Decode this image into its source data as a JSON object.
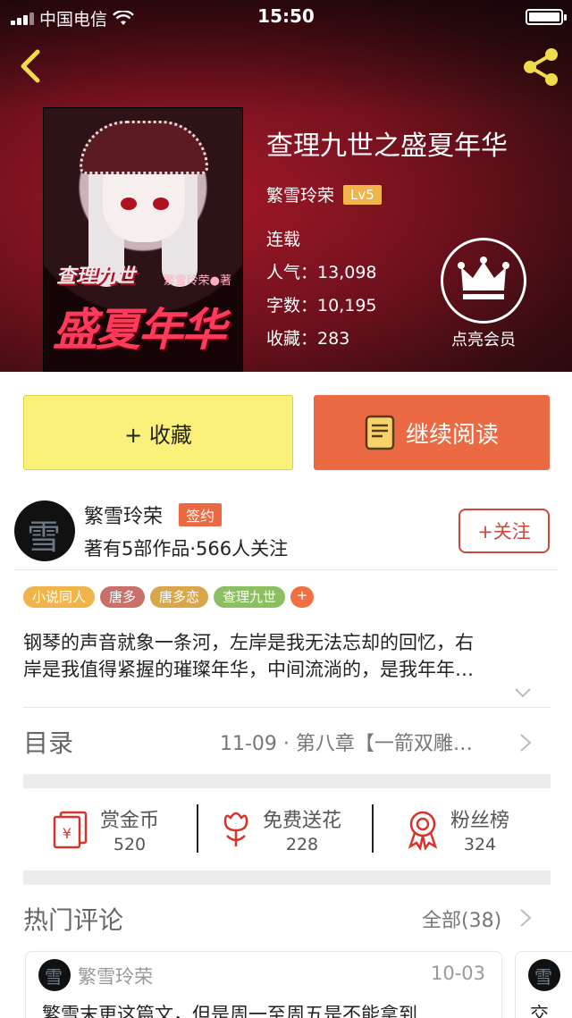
{
  "status_bar": {
    "carrier": "中国电信",
    "time": "15:50"
  },
  "book": {
    "title": "查理九世之盛夏年华",
    "author": "繁雪玲荣",
    "level": "Lv5",
    "status": "连载",
    "popularity_label": "人气：",
    "popularity": "13,098",
    "words_label": "字数：",
    "words": "10,195",
    "favorites_label": "收藏：",
    "favorites": "283",
    "cover_text_1": "查理九世",
    "cover_text_2": "盛夏年华",
    "cover_author_mark": "繁雪玲荣●著"
  },
  "member": {
    "label": "点亮会员"
  },
  "actions": {
    "favorite": "+ 收藏",
    "read": "继续阅读"
  },
  "author_card": {
    "name": "繁雪玲荣",
    "badge": "签约",
    "subtitle": "著有5部作品·566人关注",
    "follow": "+关注"
  },
  "tags": [
    {
      "label": "小说同人",
      "color": "#f0b44a"
    },
    {
      "label": "唐多",
      "color": "#c8716a"
    },
    {
      "label": "唐多恋",
      "color": "#d9a64a"
    },
    {
      "label": "查理九世",
      "color": "#8bbf62"
    },
    {
      "label": "+",
      "color": "#f0703f"
    }
  ],
  "description": {
    "line1": "钢琴的声音就象一条河，左岸是我无法忘却的回忆，右",
    "line2": "岸是我值得紧握的璀璨年华，中间流淌的，是我年年…"
  },
  "toc": {
    "title": "目录",
    "latest": "11-09 · 第八章【一箭双雕…"
  },
  "stats": [
    {
      "label": "赏金币",
      "value": "520",
      "icon": "red-envelope-icon"
    },
    {
      "label": "免费送花",
      "value": "228",
      "icon": "flower-icon"
    },
    {
      "label": "粉丝榜",
      "value": "324",
      "icon": "ribbon-badge-icon"
    }
  ],
  "hot_comments": {
    "title": "热门评论",
    "all": "全部(38)",
    "items": [
      {
        "name": "繁雪玲荣",
        "date": "10-03",
        "text": "繁雪末更这篇文，但是周一至周五是不能拿到"
      },
      {
        "text": "交"
      }
    ]
  },
  "colors": {
    "accent": "#ec6a43",
    "favorite_bg": "#faf17a",
    "follow": "#d0463a",
    "lv_badge": "#f0b44a"
  }
}
